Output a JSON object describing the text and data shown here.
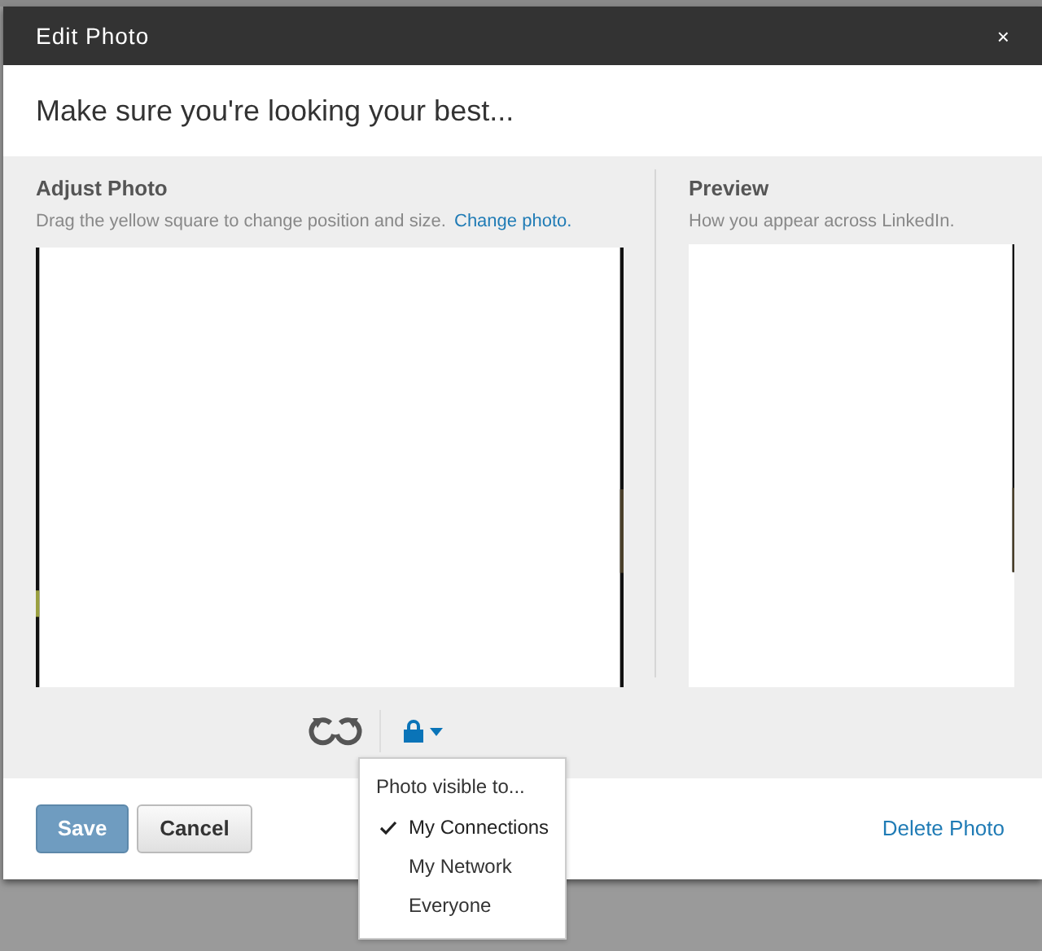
{
  "window": {
    "title": "Edit Photo",
    "close": "×"
  },
  "header": {
    "heading": "Make sure you're looking your best..."
  },
  "adjust": {
    "title": "Adjust Photo",
    "hint": "Drag the yellow square to change position and size.",
    "link": "Change photo."
  },
  "preview": {
    "title": "Preview",
    "hint": "How you appear across LinkedIn."
  },
  "visibility_menu": {
    "title": "Photo visible to...",
    "items": [
      {
        "label": "My Connections",
        "selected": true
      },
      {
        "label": "My Network",
        "selected": false
      },
      {
        "label": "Everyone",
        "selected": false
      }
    ]
  },
  "buttons": {
    "save": "Save",
    "cancel": "Cancel",
    "delete": "Delete Photo"
  }
}
